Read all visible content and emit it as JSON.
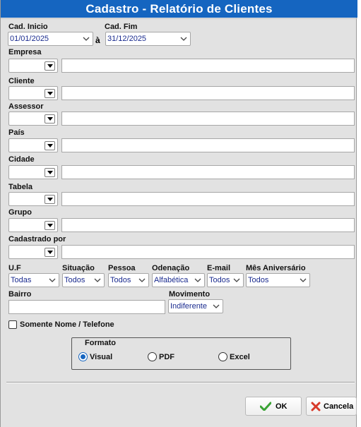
{
  "window": {
    "title": "Cadastro - Relatório de Clientes"
  },
  "dates": {
    "start_label": "Cad. Inicio",
    "start_value": "01/01/2025",
    "separator": "à",
    "end_label": "Cad. Fim",
    "end_value": "31/12/2025"
  },
  "filters": [
    {
      "label": "Empresa"
    },
    {
      "label": "Cliente"
    },
    {
      "label": "Assessor"
    },
    {
      "label": "País"
    },
    {
      "label": "Cidade"
    },
    {
      "label": "Tabela"
    },
    {
      "label": "Grupo"
    },
    {
      "label": "Cadastrado por"
    }
  ],
  "selects": {
    "uf": {
      "label": "U.F",
      "value": "Todas"
    },
    "situacao": {
      "label": "Situação",
      "value": "Todos"
    },
    "pessoa": {
      "label": "Pessoa",
      "value": "Todos"
    },
    "ordenacao": {
      "label": "Odenação",
      "value": "Alfabética"
    },
    "email": {
      "label": "E-mail",
      "value": "Todos"
    },
    "aniversario": {
      "label": "Mês Aniversário",
      "value": "Todos"
    }
  },
  "bairro": {
    "label": "Bairro",
    "value": ""
  },
  "movimento": {
    "label": "Movimento",
    "value": "Indiferente"
  },
  "somente": {
    "label": "Somente Nome / Telefone",
    "checked": false
  },
  "formato": {
    "title": "Formato",
    "options": [
      "Visual",
      "PDF",
      "Excel"
    ],
    "selected": "Visual"
  },
  "buttons": {
    "ok": "OK",
    "cancel": "Cancela"
  },
  "colors": {
    "titlebar": "#1565c0",
    "value_text": "#1a2b8f",
    "ok_icon": "#3aa335",
    "cancel_icon": "#d83a2a"
  }
}
